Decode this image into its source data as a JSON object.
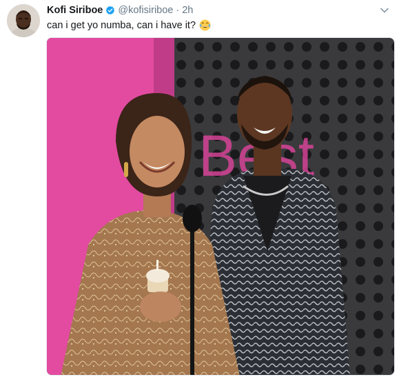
{
  "tweet": {
    "display_name": "Kofi Siriboe",
    "handle": "@kofisiriboe",
    "separator": "·",
    "timestamp": "2h",
    "text": "can i get yo numba, can i have it?",
    "emoji": "face-with-tears-of-joy",
    "media": {
      "stage_sign_text": "Best",
      "sign_color": "#e0459d"
    }
  },
  "colors": {
    "verified": "#1da1f2",
    "name": "#14171a",
    "meta": "#657786",
    "accent_pink": "#e24ba0"
  },
  "icons": [
    "avatar-photo",
    "verified-badge-icon",
    "chevron-down-icon",
    "laughing-emoji-icon"
  ]
}
